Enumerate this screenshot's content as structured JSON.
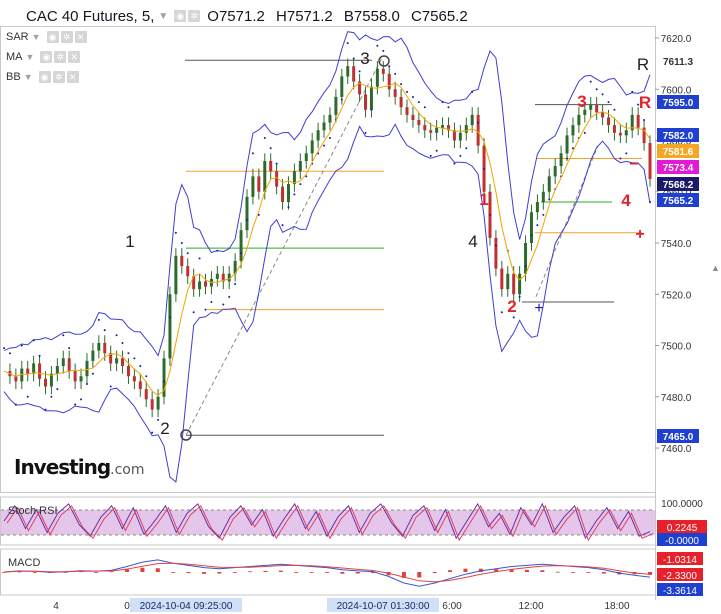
{
  "header": {
    "title": "CAC 40 Futures, 5,",
    "open": "O7571.2",
    "high": "H7571.2",
    "low": "B7558.0",
    "close": "C7565.2"
  },
  "indicators": [
    "SAR",
    "MA",
    "BB"
  ],
  "watermark": {
    "brand": "Investing",
    "suffix": ".com"
  },
  "colors": {
    "bollinger": "#3f3fd0",
    "sar": "#1a1aa8",
    "ma": "#f0a500",
    "candle": "#2d6b2d",
    "wave_black": "#222222",
    "wave_red": "#e0242d",
    "level_gray": "#555555",
    "level_orange": "#f0a030",
    "level_green": "#2eaa2e",
    "stoch_fill": "#e3c6ea",
    "stoch_line": "#6a2fa8",
    "macd_line": "#3a56d0",
    "signal_line": "#e24444",
    "hist": "#e04040"
  },
  "chart_data": [
    {
      "type": "line",
      "title": "CAC 40 Futures, 5,",
      "ylim": [
        7450,
        7625
      ],
      "y_ticks": [
        7460,
        7480,
        7500,
        7520,
        7540,
        7560,
        7580,
        7600,
        7620
      ],
      "x_tick_labels": [
        "4",
        "0",
        "6:00",
        "12:00",
        "18:00"
      ],
      "x_highlight_labels": [
        "2024-10-04 09:25:00",
        "2024-10-07 01:30:00"
      ],
      "series": [
        {
          "values": [
            7490,
            7488,
            7486,
            7491,
            7489,
            7493,
            7487,
            7484,
            7489,
            7492,
            7495,
            7490,
            7486,
            7488,
            7494,
            7498,
            7501,
            7497,
            7493,
            7495,
            7492,
            7488,
            7486,
            7483,
            7479,
            7475,
            7480,
            7495,
            7520,
            7535,
            7531,
            7527,
            7522,
            7525,
            7523,
            7526,
            7528,
            7525,
            7528,
            7533,
            7545,
            7558,
            7566,
            7560,
            7572,
            7568,
            7562,
            7556,
            7563,
            7568,
            7572,
            7575,
            7580,
            7584,
            7587,
            7590,
            7597,
            7605,
            7609,
            7603,
            7598,
            7592,
            7601,
            7608,
            7606,
            7600,
            7597,
            7593,
            7590,
            7588,
            7586,
            7584,
            7583,
            7585,
            7586,
            7584,
            7580,
            7583,
            7586,
            7590,
            7578,
            7560,
            7542,
            7530,
            7522,
            7528,
            7520,
            7528,
            7540,
            7552,
            7556,
            7560,
            7566,
            7570,
            7575,
            7582,
            7586,
            7590,
            7592,
            7594,
            7591,
            7589,
            7586,
            7583,
            7582,
            7584,
            7590,
            7585,
            7579,
            7565
          ]
        }
      ],
      "price_labels": [
        "7611.3",
        "7595.0",
        "7582.0",
        "7581.6",
        "7573.4",
        "7568.2",
        "7565.2",
        "7465.0"
      ],
      "level_lines": [
        {
          "value": 7611.3,
          "color": "gray"
        },
        {
          "value": 7568,
          "color": "orange"
        },
        {
          "value": 7538,
          "color": "green"
        },
        {
          "value": 7514,
          "color": "orange"
        },
        {
          "value": 7465,
          "color": "gray"
        },
        {
          "value": 7594,
          "color": "gray"
        },
        {
          "value": 7573,
          "color": "orange"
        },
        {
          "value": 7556,
          "color": "green"
        },
        {
          "value": 7544,
          "color": "orange"
        },
        {
          "value": 7517,
          "color": "gray"
        }
      ],
      "wave_labels": [
        {
          "text": "1",
          "color": "black"
        },
        {
          "text": "2",
          "color": "black"
        },
        {
          "text": "3",
          "color": "black"
        },
        {
          "text": "4",
          "color": "black"
        },
        {
          "text": "1",
          "color": "red"
        },
        {
          "text": "2",
          "color": "red"
        },
        {
          "text": "3",
          "color": "red"
        },
        {
          "text": "4",
          "color": "red"
        },
        {
          "text": "R",
          "color": "black"
        },
        {
          "text": "R",
          "color": "red"
        },
        {
          "text": "−",
          "color": "red"
        },
        {
          "text": "+",
          "color": "red"
        },
        {
          "text": "+",
          "color": "blue"
        }
      ]
    },
    {
      "type": "line",
      "title": "Stoch RSI",
      "y_ticks_labels": [
        "100.0000",
        "0.2245",
        "-0.0000"
      ],
      "series": [
        {
          "values": [
            0.5,
            0.9,
            0.3,
            0.8,
            0.2,
            0.7,
            0.95,
            0.4,
            0.1,
            0.6,
            0.9,
            0.3,
            0.85,
            0.15,
            0.5,
            0.9,
            0.2,
            0.7,
            0.95,
            0.35,
            0.05,
            0.6,
            0.9,
            0.4,
            0.8,
            0.1,
            0.55,
            0.95,
            0.3,
            0.75,
            0.1,
            0.6,
            0.9,
            0.2,
            0.7,
            0.95,
            0.45,
            0.1,
            0.65,
            0.9,
            0.25,
            0.8,
            0.05,
            0.5,
            0.95,
            0.35,
            0.7,
            0.15,
            0.85,
            0.4,
            0.95,
            0.2,
            0.6,
            0.9,
            0.05,
            0.5,
            0.85,
            0.3,
            0.75,
            0.1,
            0.22
          ]
        }
      ]
    },
    {
      "type": "line",
      "title": "MACD",
      "y_ticks_labels": [
        "-1.0314",
        "-2.3300",
        "-3.3614"
      ],
      "series": [
        {
          "values": [
            0,
            0.5,
            0.3,
            -0.2,
            0.1,
            0.6,
            0.4,
            0.8,
            2.5,
            4.5,
            5.5,
            4.0,
            3.0,
            2.0,
            1.5,
            2.0,
            2.5,
            3.0,
            3.5,
            3.0,
            2.5,
            2.0,
            1.0,
            0.5,
            0.2,
            -2.0,
            -5.0,
            -6.5,
            -5.0,
            -3.0,
            -1.0,
            0.5,
            1.5,
            2.5,
            3.0,
            3.5,
            3.0,
            2.5,
            2.0,
            1.0,
            -0.5,
            -1.5,
            -2.3
          ]
        },
        {
          "values": [
            0,
            0.3,
            0.3,
            0.1,
            0.1,
            0.3,
            0.4,
            0.5,
            1.3,
            2.6,
            3.8,
            4.0,
            3.5,
            2.8,
            2.2,
            2.1,
            2.2,
            2.5,
            2.9,
            3.0,
            2.8,
            2.4,
            1.8,
            1.2,
            0.7,
            -0.5,
            -2.3,
            -4.0,
            -4.5,
            -3.8,
            -2.5,
            -1.0,
            0.2,
            1.2,
            2.0,
            2.7,
            2.9,
            2.7,
            2.3,
            1.7,
            0.6,
            -0.5,
            -1.0
          ]
        }
      ]
    }
  ]
}
